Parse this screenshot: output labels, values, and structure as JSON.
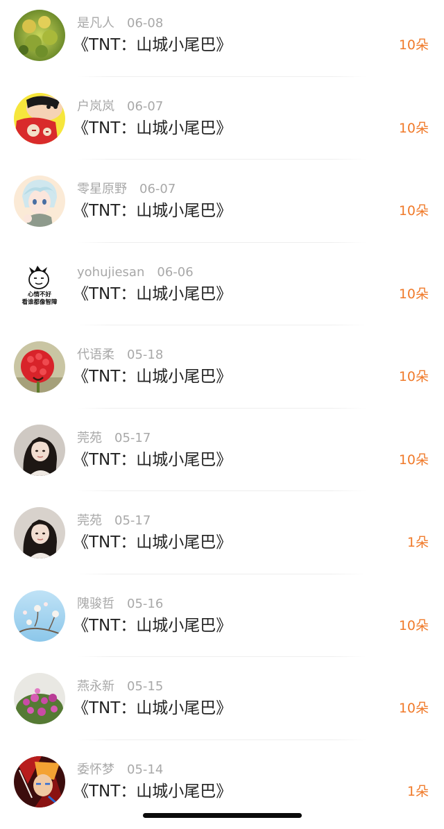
{
  "gift_list": [
    {
      "name": "是凡人",
      "date": "06-08",
      "work": "《TNT：山城小尾巴》",
      "count": "10朵",
      "avatar": "green-leaves-avatar"
    },
    {
      "name": "户岚岚",
      "date": "06-07",
      "work": "《TNT：山城小尾巴》",
      "count": "10朵",
      "avatar": "cartoon-boy-avatar"
    },
    {
      "name": "零星原野",
      "date": "06-07",
      "work": "《TNT：山城小尾巴》",
      "count": "10朵",
      "avatar": "anime-character-avatar"
    },
    {
      "name": "yohujiesan",
      "date": "06-06",
      "work": "《TNT：山城小尾巴》",
      "count": "10朵",
      "avatar": "meme-sticker-avatar",
      "avatar_text": [
        "心情不好",
        "看谁都像智障"
      ]
    },
    {
      "name": "代语柔",
      "date": "05-18",
      "work": "《TNT：山城小尾巴》",
      "count": "10朵",
      "avatar": "raspberry-avatar"
    },
    {
      "name": "莞苑",
      "date": "05-17",
      "work": "《TNT：山城小尾巴》",
      "count": "10朵",
      "avatar": "girl-portrait-avatar"
    },
    {
      "name": "莞苑",
      "date": "05-17",
      "work": "《TNT：山城小尾巴》",
      "count": "1朵",
      "avatar": "girl-portrait-avatar"
    },
    {
      "name": "隗骏哲",
      "date": "05-16",
      "work": "《TNT：山城小尾巴》",
      "count": "10朵",
      "avatar": "sky-blossom-avatar"
    },
    {
      "name": "燕永新",
      "date": "05-15",
      "work": "《TNT：山城小尾巴》",
      "count": "10朵",
      "avatar": "pink-flowers-avatar"
    },
    {
      "name": "委怀梦",
      "date": "05-14",
      "work": "《TNT：山城小尾巴》",
      "count": "1朵",
      "avatar": "anime-ninja-avatar"
    }
  ],
  "colors": {
    "count": "#f07a2a",
    "meta": "#a8a8a8",
    "title": "#222222"
  }
}
